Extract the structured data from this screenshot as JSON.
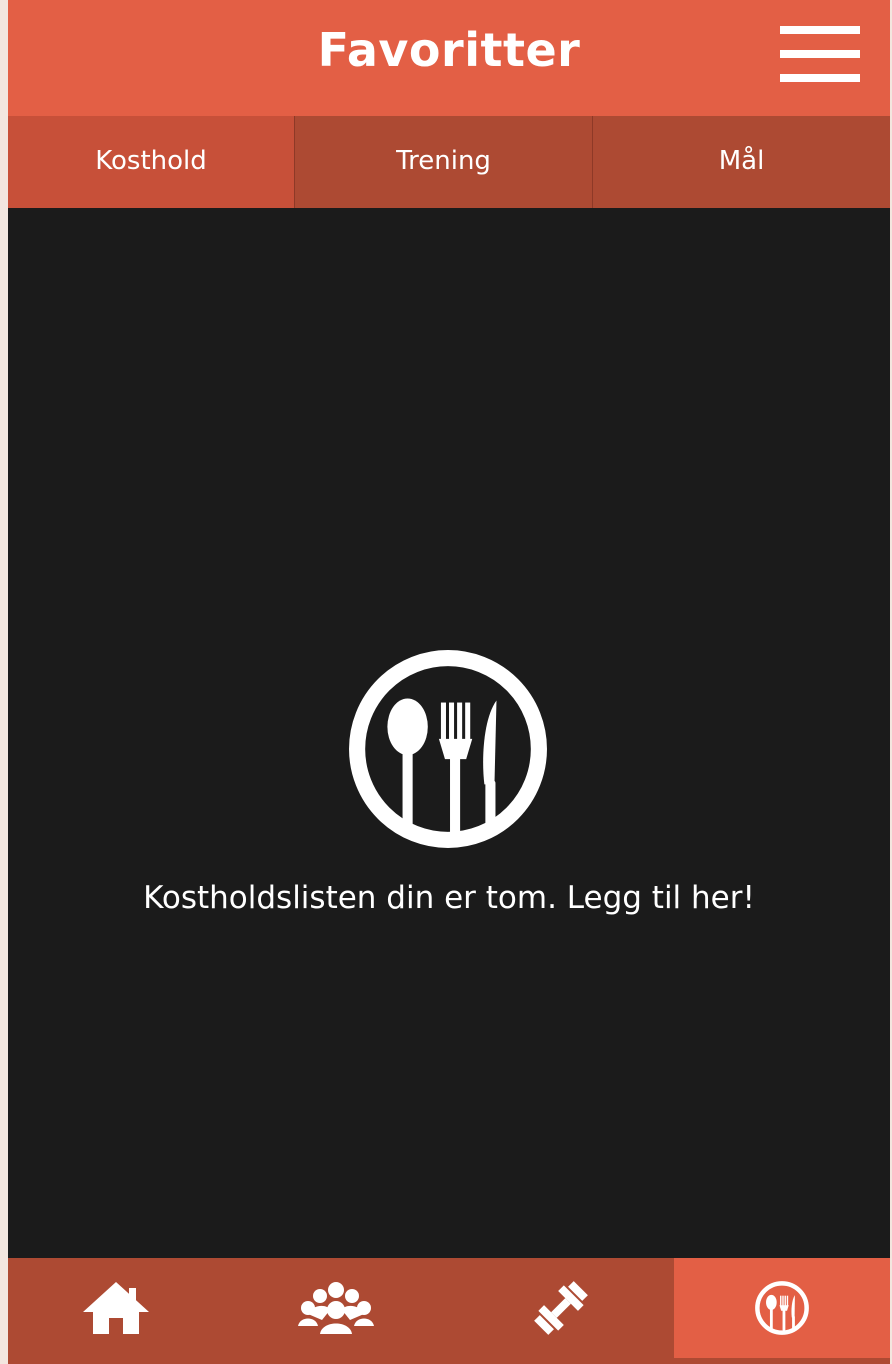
{
  "header": {
    "title": "Favoritter",
    "menu_icon": "hamburger-menu-icon"
  },
  "tabs": [
    {
      "label": "Kosthold",
      "active": true
    },
    {
      "label": "Trening",
      "active": false
    },
    {
      "label": "Mål",
      "active": false
    }
  ],
  "empty_state": {
    "icon": "cutlery-circle-icon",
    "message": "Kostholdslisten din er tom. Legg til her!"
  },
  "bottom_nav": [
    {
      "icon": "home-icon",
      "active": false
    },
    {
      "icon": "group-icon",
      "active": false
    },
    {
      "icon": "dumbbell-icon",
      "active": false
    },
    {
      "icon": "cutlery-icon",
      "active": true
    }
  ],
  "colors": {
    "accent": "#e35f45",
    "tab_bar": "#ad4a33",
    "active_tab": "#c75039",
    "background": "#1b1b1b",
    "text": "#ffffff"
  }
}
